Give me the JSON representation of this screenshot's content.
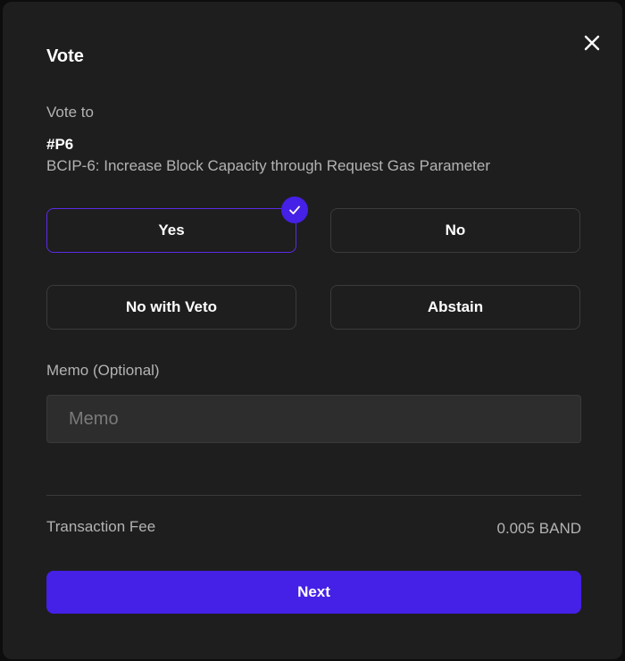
{
  "modal": {
    "title": "Vote",
    "close_icon": "close-icon"
  },
  "proposal": {
    "vote_to_label": "Vote to",
    "id": "#P6",
    "title": "BCIP-6: Increase Block Capacity through Request Gas Parameter"
  },
  "options": {
    "yes": "Yes",
    "no": "No",
    "no_with_veto": "No with Veto",
    "abstain": "Abstain",
    "selected": "Yes",
    "selected_icon": "checkmark-icon"
  },
  "memo": {
    "label": "Memo (Optional)",
    "placeholder": "Memo",
    "value": ""
  },
  "fee": {
    "label": "Transaction Fee",
    "value": "0.005 BAND"
  },
  "actions": {
    "next_label": "Next"
  },
  "colors": {
    "accent": "#4520e6",
    "background": "#1e1e1e"
  }
}
